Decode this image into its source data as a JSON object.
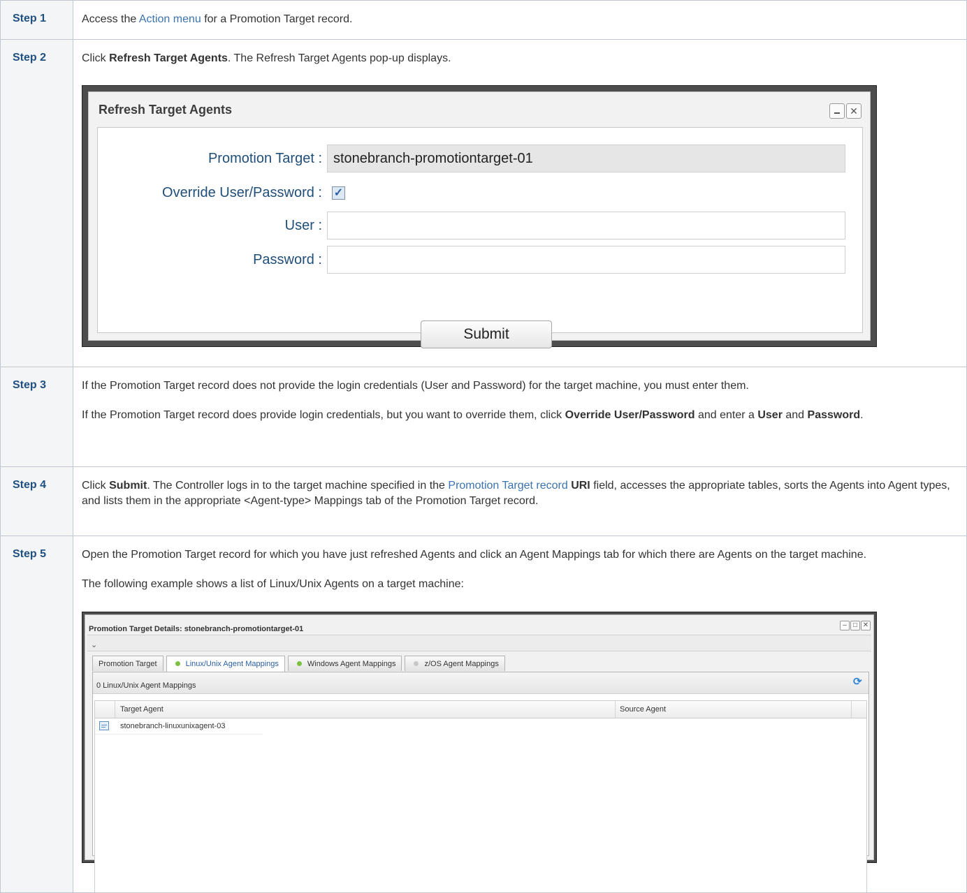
{
  "steps": [
    {
      "label": "Step 1",
      "pre": "Access the ",
      "link": "Action menu",
      "post": " for a Promotion Target record."
    },
    {
      "label": "Step 2",
      "pre": "Click ",
      "bold": "Refresh Target Agents",
      "post": ". The Refresh Target Agents pop-up displays."
    },
    {
      "label": "Step 3",
      "p1": "If the Promotion Target record does not provide the login credentials (User and Password) for the target machine, you must enter them.",
      "p2_pre": "If the Promotion Target record does provide login credentials, but you want to override them, click ",
      "p2_b1": "Override User/Password",
      "p2_mid": " and enter a ",
      "p2_b2": "User",
      "p2_and": " and ",
      "p2_b3": "Password",
      "p2_end": "."
    },
    {
      "label": "Step 4",
      "pre": "Click ",
      "bold": "Submit",
      "mid": ". The Controller logs in to the target machine specified in the ",
      "link": "Promotion Target record",
      "sp": " ",
      "bold2": "URI",
      "post": " field, accesses the appropriate tables, sorts the Agents into Agent types, and lists them in the appropriate <Agent-type> Mappings tab of the Promotion Target record."
    },
    {
      "label": "Step 5",
      "p1": "Open the Promotion Target record for which you have just refreshed Agents and click an Agent Mappings tab for which there are Agents on the target machine.",
      "p2": "The following example shows a list of Linux/Unix Agents on a target machine:"
    }
  ],
  "dialog": {
    "title": "Refresh Target Agents",
    "promotion_target_label": "Promotion Target :",
    "promotion_target_value": "stonebranch-promotiontarget-01",
    "override_label": "Override User/Password :",
    "override_checked": "✓",
    "user_label": "User :",
    "user_value": "",
    "password_label": "Password :",
    "password_value": "",
    "submit": "Submit",
    "min": "",
    "close": "✕"
  },
  "details": {
    "title": "Promotion Target Details: stonebranch-promotiontarget-01",
    "toolbar_chevron": "⌄",
    "tabs": [
      {
        "label": "Promotion Target"
      },
      {
        "label": "Linux/Unix Agent Mappings",
        "dot": "#7cc242"
      },
      {
        "label": "Windows Agent Mappings",
        "dot": "#7cc242"
      },
      {
        "label": "z/OS Agent Mappings",
        "dot": "#c8c8c8"
      }
    ],
    "count_label": "0 Linux/Unix Agent Mappings",
    "columns": [
      "Target Agent",
      "Source Agent"
    ],
    "rows": [
      {
        "target": "stonebranch-linuxunixagent-03"
      }
    ],
    "win_min": "–",
    "win_max": "□",
    "win_close": "✕"
  },
  "colors": {
    "step_label": "#205081",
    "link": "#3b73af",
    "header_bg": "#f4f5f7"
  }
}
